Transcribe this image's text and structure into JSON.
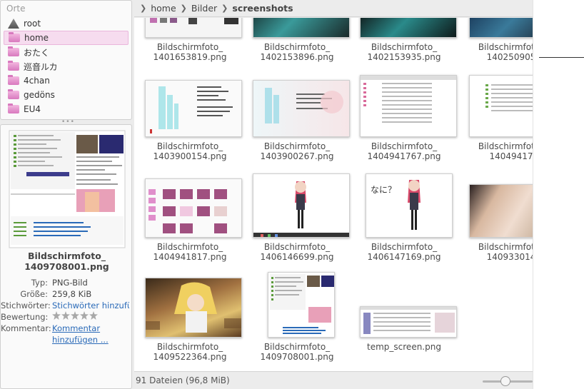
{
  "places": {
    "title": "Orte",
    "items": [
      {
        "label": "root",
        "icon": "tree-icon"
      },
      {
        "label": "home",
        "icon": "folder-icon",
        "selected": true
      },
      {
        "label": "おたく",
        "icon": "folder-icon"
      },
      {
        "label": "巡音ルカ",
        "icon": "folder-icon"
      },
      {
        "label": "4chan",
        "icon": "folder-icon"
      },
      {
        "label": "gedöns",
        "icon": "folder-icon"
      },
      {
        "label": "EU4",
        "icon": "folder-icon"
      }
    ]
  },
  "info": {
    "filename_line1": "Bildschirmfoto_",
    "filename_line2": "1409708001.png",
    "type_label": "Typ:",
    "type_value": "PNG-Bild",
    "size_label": "Größe:",
    "size_value": "259,8 KiB",
    "tags_label": "Stichwörter:",
    "tags_value": "Stichwörter hinzufügen ...",
    "rating_label": "Bewertung:",
    "rating_stars": 0,
    "comment_label": "Kommentar:",
    "comment_value": "Kommentar hinzufügen ..."
  },
  "breadcrumb": [
    "home",
    "Bilder",
    "screenshots"
  ],
  "files": [
    {
      "line1": "Bildschirmfoto_",
      "line2": "1401653819.png"
    },
    {
      "line1": "Bildschirmfoto_",
      "line2": "1402153896.png"
    },
    {
      "line1": "Bildschirmfoto_",
      "line2": "1402153935.png"
    },
    {
      "line1": "Bildschirmfoto_",
      "line2": "140250905"
    },
    {
      "line1": "Bildschirmfoto_",
      "line2": "1403900154.png"
    },
    {
      "line1": "Bildschirmfoto_",
      "line2": "1403900267.png"
    },
    {
      "line1": "Bildschirmfoto_",
      "line2": "1404941767.png"
    },
    {
      "line1": "Bildschirmfoto_",
      "line2": "14049417"
    },
    {
      "line1": "Bildschirmfoto_",
      "line2": "1404941817.png"
    },
    {
      "line1": "Bildschirmfoto_",
      "line2": "1406146699.png"
    },
    {
      "line1": "Bildschirmfoto_",
      "line2": "1406147169.png",
      "overlay_text": "なに？"
    },
    {
      "line1": "Bildschirmfoto_",
      "line2": "140933014"
    },
    {
      "line1": "Bildschirmfoto_",
      "line2": "1409522364.png"
    },
    {
      "line1": "Bildschirmfoto_",
      "line2": "1409708001.png"
    },
    {
      "line1": "temp_screen.png",
      "line2": ""
    }
  ],
  "status": {
    "count_text": "91 Dateien (96,8 MiB)",
    "zoom_fraction": 0.45
  },
  "colors": {
    "selection": "#f6dcef",
    "folder": "#e08fcb",
    "link": "#2a6ab8"
  }
}
